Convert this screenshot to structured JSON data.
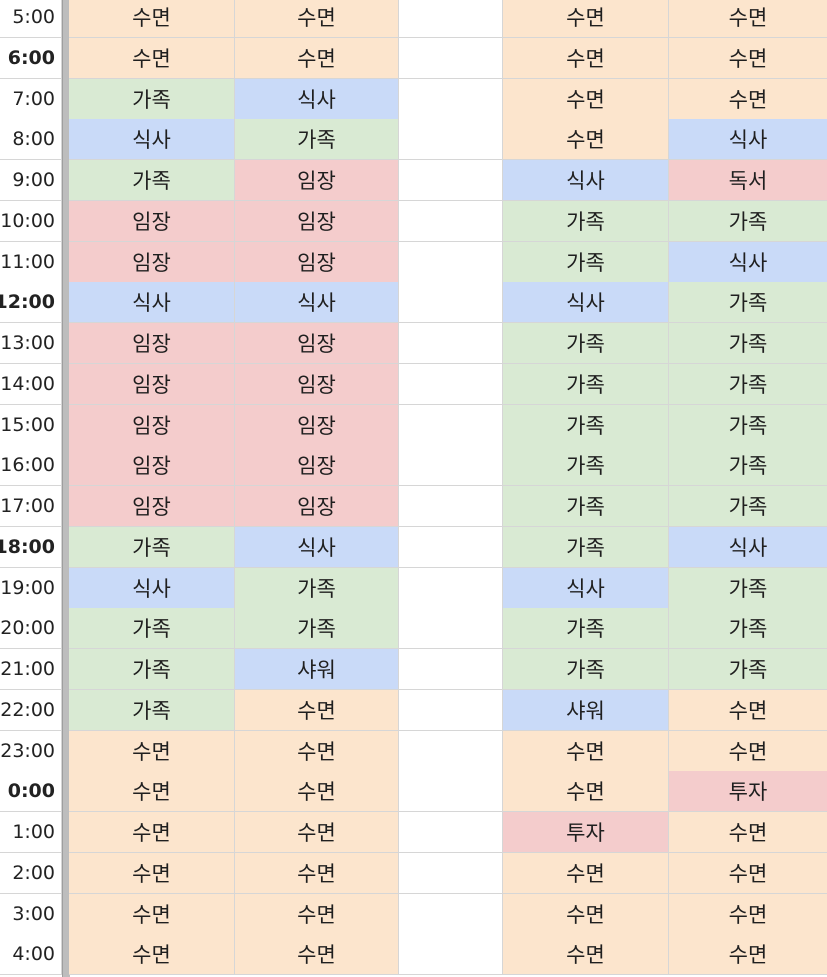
{
  "colors": {
    "수면": "#fce5cd",
    "가족": "#d9ead3",
    "식사": "#c9daf8",
    "임장": "#f4cccc",
    "샤워": "#c9daf8",
    "독서": "#f4cccc",
    "투자": "#f4cccc"
  },
  "rows": [
    {
      "time": "5:00",
      "bold": false,
      "cells": [
        "수면",
        "수면",
        "",
        "수면",
        "수면"
      ]
    },
    {
      "time": "6:00",
      "bold": true,
      "cells": [
        "수면",
        "수면",
        "",
        "수면",
        "수면"
      ]
    },
    {
      "time": "7:00",
      "bold": false,
      "cells": [
        "가족",
        "식사",
        "",
        "수면",
        "수면"
      ]
    },
    {
      "time": "8:00",
      "bold": false,
      "cells": [
        "식사",
        "가족",
        "",
        "수면",
        "식사"
      ]
    },
    {
      "time": "9:00",
      "bold": false,
      "cells": [
        "가족",
        "임장",
        "",
        "식사",
        "독서"
      ]
    },
    {
      "time": "10:00",
      "bold": false,
      "cells": [
        "임장",
        "임장",
        "",
        "가족",
        "가족"
      ]
    },
    {
      "time": "11:00",
      "bold": false,
      "cells": [
        "임장",
        "임장",
        "",
        "가족",
        "식사"
      ]
    },
    {
      "time": "12:00",
      "bold": true,
      "cells": [
        "식사",
        "식사",
        "",
        "식사",
        "가족"
      ]
    },
    {
      "time": "13:00",
      "bold": false,
      "cells": [
        "임장",
        "임장",
        "",
        "가족",
        "가족"
      ]
    },
    {
      "time": "14:00",
      "bold": false,
      "cells": [
        "임장",
        "임장",
        "",
        "가족",
        "가족"
      ]
    },
    {
      "time": "15:00",
      "bold": false,
      "cells": [
        "임장",
        "임장",
        "",
        "가족",
        "가족"
      ]
    },
    {
      "time": "16:00",
      "bold": false,
      "cells": [
        "임장",
        "임장",
        "",
        "가족",
        "가족"
      ]
    },
    {
      "time": "17:00",
      "bold": false,
      "cells": [
        "임장",
        "임장",
        "",
        "가족",
        "가족"
      ]
    },
    {
      "time": "18:00",
      "bold": true,
      "cells": [
        "가족",
        "식사",
        "",
        "가족",
        "식사"
      ]
    },
    {
      "time": "19:00",
      "bold": false,
      "cells": [
        "식사",
        "가족",
        "",
        "식사",
        "가족"
      ]
    },
    {
      "time": "20:00",
      "bold": false,
      "cells": [
        "가족",
        "가족",
        "",
        "가족",
        "가족"
      ]
    },
    {
      "time": "21:00",
      "bold": false,
      "cells": [
        "가족",
        "샤워",
        "",
        "가족",
        "가족"
      ]
    },
    {
      "time": "22:00",
      "bold": false,
      "cells": [
        "가족",
        "수면",
        "",
        "샤워",
        "수면"
      ]
    },
    {
      "time": "23:00",
      "bold": false,
      "cells": [
        "수면",
        "수면",
        "",
        "수면",
        "수면"
      ]
    },
    {
      "time": "0:00",
      "bold": true,
      "cells": [
        "수면",
        "수면",
        "",
        "수면",
        "투자"
      ]
    },
    {
      "time": "1:00",
      "bold": false,
      "cells": [
        "수면",
        "수면",
        "",
        "투자",
        "수면"
      ]
    },
    {
      "time": "2:00",
      "bold": false,
      "cells": [
        "수면",
        "수면",
        "",
        "수면",
        "수면"
      ]
    },
    {
      "time": "3:00",
      "bold": false,
      "cells": [
        "수면",
        "수면",
        "",
        "수면",
        "수면"
      ]
    },
    {
      "time": "4:00",
      "bold": false,
      "cells": [
        "수면",
        "수면",
        "",
        "수면",
        "수면"
      ]
    }
  ]
}
